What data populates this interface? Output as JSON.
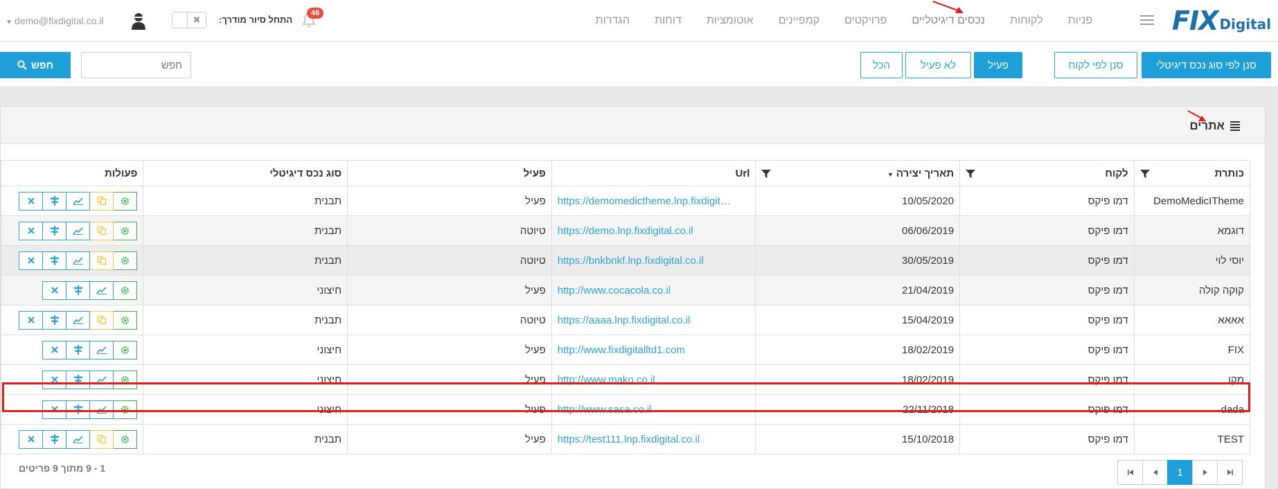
{
  "logo": {
    "fix": "FIX",
    "digital": "Digital"
  },
  "nav": {
    "items": [
      "פניות",
      "לקוחות",
      "נכסים דיגיטליים",
      "פרויקטים",
      "קמפיינים",
      "אוטומציות",
      "דוחות",
      "הגדרות"
    ],
    "tour_label": "התחל סיור מודרך:",
    "notifications": "46",
    "user_email": "demo@fixdigital.co.il"
  },
  "toolbar": {
    "scan_by_type": "סנן לפי סוג נכס דיגיטלי",
    "scan_by_client": "סנן לפי לקוח",
    "active": "פעיל",
    "inactive": "לא פעיל",
    "all": "הכל",
    "search_placeholder": "חפש",
    "search_button": "חפש"
  },
  "panel": {
    "title": "אתרים"
  },
  "grid": {
    "headers": {
      "title": "כותרת",
      "client": "לקוח",
      "created": "תאריך יצירה",
      "url": "Url",
      "active": "פעיל",
      "type": "סוג נכס דיגיטלי",
      "actions": "פעולות"
    },
    "rows": [
      {
        "title": "DemoMedicITheme",
        "client": "דמו פיקס",
        "created": "10/05/2020",
        "url": "https://demomedictheme.lnp.fixdigit…",
        "active": "פעיל",
        "type": "תבנית",
        "copy": true
      },
      {
        "title": "דוגמא",
        "client": "דמו פיקס",
        "created": "06/06/2019",
        "url": "https://demo.lnp.fixdigital.co.il",
        "active": "טיוטה",
        "type": "תבנית",
        "copy": true
      },
      {
        "title": "יוסי לוי",
        "client": "דמו פיקס",
        "created": "30/05/2019",
        "url": "https://bnkbnkf.lnp.fixdigital.co.il",
        "active": "טיוטה",
        "type": "תבנית",
        "copy": true
      },
      {
        "title": "קוקה קולה",
        "client": "דמו פיקס",
        "created": "21/04/2019",
        "url": "http://www.cocacola.co.il",
        "active": "פעיל",
        "type": "חיצוני",
        "copy": false
      },
      {
        "title": "אאאא",
        "client": "דמו פיקס",
        "created": "15/04/2019",
        "url": "https://aaaa.lnp.fixdigital.co.il",
        "active": "טיוטה",
        "type": "תבנית",
        "copy": true
      },
      {
        "title": "FIX",
        "client": "דמו פיקס",
        "created": "18/02/2019",
        "url": "http://www.fixdigitalltd1.com",
        "active": "פעיל",
        "type": "חיצוני",
        "copy": false
      },
      {
        "title": "מקו",
        "client": "דמו פיקס",
        "created": "18/02/2019",
        "url": "http://www.mako.co.il",
        "active": "פעיל",
        "type": "חיצוני",
        "copy": false
      },
      {
        "title": "dada",
        "client": "דמו פיקס",
        "created": "22/11/2018",
        "url": "http://www.sasa.co.il",
        "active": "פעיל",
        "type": "חיצוני",
        "copy": false
      },
      {
        "title": "TEST",
        "client": "דמו פיקס",
        "created": "15/10/2018",
        "url": "https://test111.lnp.fixdigital.co.il",
        "active": "פעיל",
        "type": "תבנית",
        "copy": true
      }
    ]
  },
  "pager": {
    "current": "1",
    "info": "1 - 9 מתוך 9 פריטים"
  },
  "colors": {
    "accent": "#1e9fd8",
    "green": "#43b14b",
    "yellow": "#f2c94c",
    "highlight": "#e41c1c"
  }
}
